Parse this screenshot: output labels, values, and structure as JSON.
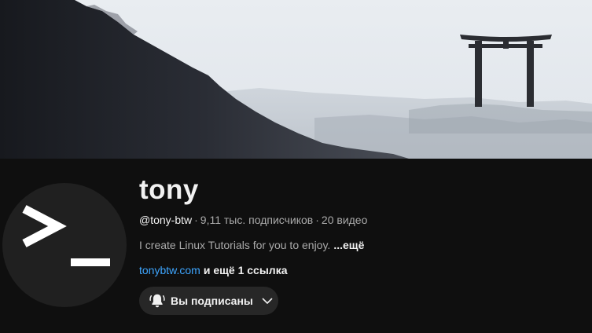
{
  "channel": {
    "name": "tony",
    "handle": "@tony-btw",
    "separator": "·",
    "subscribers": "9,11 тыс. подписчиков",
    "videos": "20 видео",
    "description": "I create Linux Tutorials for you to enjoy.",
    "more_label": "...ещё",
    "link": "tonybtw.com",
    "extra_links": "и ещё 1 ссылка",
    "subscribe_state_label": "Вы подписаны"
  },
  "icons": {
    "bell": "bell-ringing-icon",
    "chevron": "chevron-down-icon",
    "avatar_glyph": "terminal-prompt-icon",
    "banner_landmark": "torii-gate-icon"
  },
  "colors": {
    "background": "#0f0f0f",
    "text_primary": "#f1f1f1",
    "text_secondary": "#aaaaaa",
    "link": "#3ea6ff",
    "button_bg": "#272727",
    "avatar_bg": "#202020",
    "banner_sky": "#e7ebef",
    "banner_mountain": "#22252c"
  }
}
